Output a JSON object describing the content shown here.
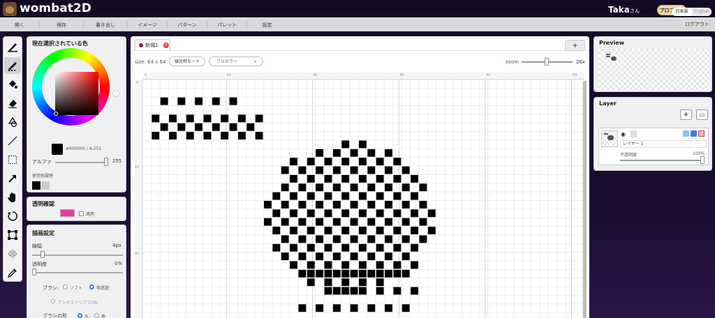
{
  "app": {
    "title": "wombat2D",
    "user_name": "Taka",
    "user_suffix": "さん",
    "pro_label": "プロプラン",
    "lang_ja": "日本語",
    "lang_en": "English"
  },
  "menu": {
    "items": [
      "開く",
      "保存",
      "書き出し",
      "イメージ",
      "パターン",
      "パレット",
      "設定"
    ],
    "logout": "ログアウト"
  },
  "tools": [
    "brush-icon",
    "pattern-brush-icon",
    "fill-icon",
    "eraser-icon",
    "shape-icon",
    "line-icon",
    "select-rect-icon",
    "arrow-icon",
    "hand-icon",
    "rotate-icon",
    "transform-icon",
    "mirror-icon",
    "eyedropper-icon"
  ],
  "color_panel": {
    "title": "現在選択されている色",
    "current": "#000000 / A:255",
    "alpha_label": "アルファ",
    "alpha_value": "255",
    "alpha_fraction": 1.0,
    "history_label": "使用色履歴",
    "history": [
      "#000000",
      "#cccccc"
    ]
  },
  "transparency": {
    "title": "透明確認",
    "color": "#e040a0",
    "apply_label": "適用"
  },
  "draw_settings": {
    "title": "描画設定",
    "width_label": "線幅",
    "width_value": "4px",
    "opacity_label": "透明度",
    "opacity_value": "0%",
    "brush_label": "ブラシ:",
    "brush_soft": "ソフト",
    "brush_hard": "等透過",
    "antialias": "アンチエイリアスON",
    "shape_label": "ブラシの形",
    "shape_round": "丸",
    "shape_square": "角"
  },
  "canvas": {
    "tab_label": "新規1",
    "add_tab": "+",
    "size": "size: 64 x 64",
    "mirror_mode": "線対称モード",
    "color_mode": "フルカラー",
    "zoom_label": "zoom",
    "zoom_value": "26x",
    "zoom_fraction": 0.45,
    "ruler_top": [
      "0",
      "10",
      "20",
      "30",
      "40",
      "50"
    ],
    "ruler_left": [
      "0",
      "10",
      "20"
    ]
  },
  "preview": {
    "title": "Preview"
  },
  "layer": {
    "title": "Layer",
    "add": "+",
    "name": "レイヤー 1",
    "opacity_label": "不透明度",
    "opacity_value": "100%",
    "opacity_fraction": 1.0
  }
}
